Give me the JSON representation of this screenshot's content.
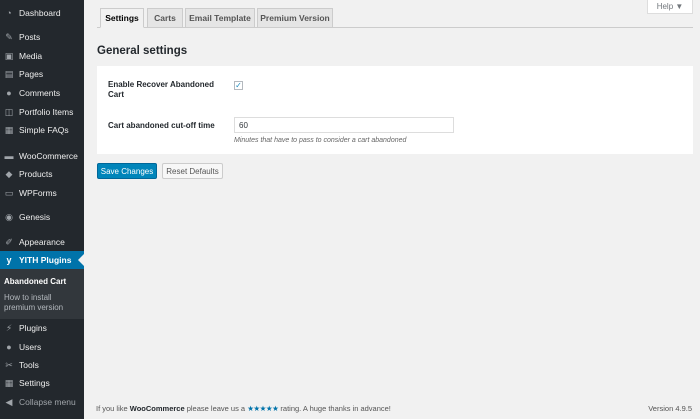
{
  "sidebar": {
    "items": [
      {
        "label": "Dashboard",
        "icon": "gauge-icon"
      },
      {
        "label": "Posts",
        "icon": "pin-icon"
      },
      {
        "label": "Media",
        "icon": "media-icon"
      },
      {
        "label": "Pages",
        "icon": "page-icon"
      },
      {
        "label": "Comments",
        "icon": "comment-icon"
      },
      {
        "label": "Portfolio Items",
        "icon": "portfolio-icon"
      },
      {
        "label": "Simple FAQs",
        "icon": "faq-icon"
      },
      {
        "label": "WooCommerce",
        "icon": "woo-icon"
      },
      {
        "label": "Products",
        "icon": "box-icon"
      },
      {
        "label": "WPForms",
        "icon": "form-icon"
      },
      {
        "label": "Genesis",
        "icon": "genesis-icon"
      },
      {
        "label": "Appearance",
        "icon": "brush-icon"
      },
      {
        "label": "YITH Plugins",
        "icon": "yith-icon"
      },
      {
        "label": "Plugins",
        "icon": "plug-icon"
      },
      {
        "label": "Users",
        "icon": "user-icon"
      },
      {
        "label": "Tools",
        "icon": "wrench-icon"
      },
      {
        "label": "Settings",
        "icon": "settings-icon"
      },
      {
        "label": "Collapse menu",
        "icon": "collapse-icon"
      }
    ],
    "submenu": {
      "current": "Abandoned Cart",
      "other": "How to install premium version"
    }
  },
  "help_label": "Help ▼",
  "tabs": [
    {
      "label": "Settings"
    },
    {
      "label": "Carts"
    },
    {
      "label": "Email Template"
    },
    {
      "label": "Premium Version"
    }
  ],
  "section_title": "General settings",
  "form": {
    "enable_label": "Enable Recover Abandoned Cart",
    "enable_checked": "✓",
    "cutoff_label": "Cart abandoned cut-off time",
    "cutoff_value": "60",
    "cutoff_description": "Minutes that have to pass to consider a cart abandoned"
  },
  "buttons": {
    "save": "Save Changes",
    "reset": "Reset Defaults"
  },
  "footer": {
    "prefix": "If you like ",
    "brand": "WooCommerce",
    "middle": " please leave us a ",
    "stars": "★★★★★",
    "suffix": " rating. A huge thanks in advance!",
    "version": "Version 4.9.5"
  }
}
